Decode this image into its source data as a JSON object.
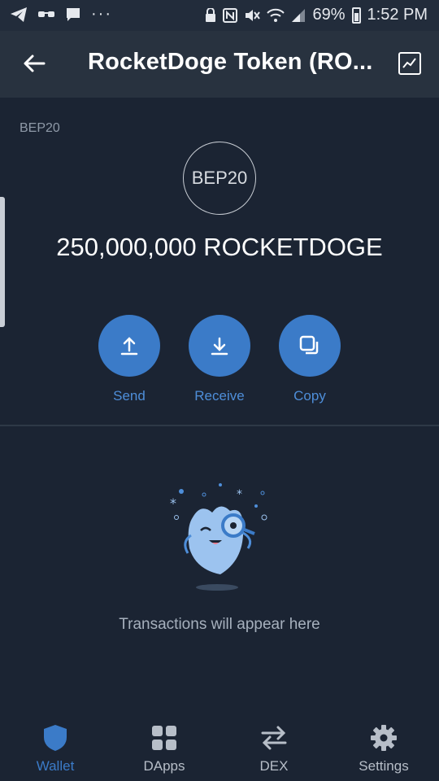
{
  "status_bar": {
    "battery_percent": "69%",
    "time": "1:52 PM"
  },
  "header": {
    "title": "RocketDoge Token (RO...",
    "back_icon": "arrow-left-icon",
    "chart_icon": "chart-icon"
  },
  "token": {
    "network": "BEP20",
    "logo_text": "BEP20",
    "balance": "250,000,000 ROCKETDOGE"
  },
  "actions": [
    {
      "label": "Send",
      "icon": "upload-icon"
    },
    {
      "label": "Receive",
      "icon": "download-icon"
    },
    {
      "label": "Copy",
      "icon": "copy-icon"
    }
  ],
  "empty_state": {
    "message": "Transactions will appear here"
  },
  "bottom_nav": [
    {
      "label": "Wallet",
      "icon": "shield-icon",
      "active": true
    },
    {
      "label": "DApps",
      "icon": "grid-icon",
      "active": false
    },
    {
      "label": "DEX",
      "icon": "swap-icon",
      "active": false
    },
    {
      "label": "Settings",
      "icon": "gear-icon",
      "active": false
    }
  ],
  "colors": {
    "background": "#1b2433",
    "header": "#28323f",
    "accent": "#3b7bc8",
    "muted_text": "#a6b0bd"
  }
}
